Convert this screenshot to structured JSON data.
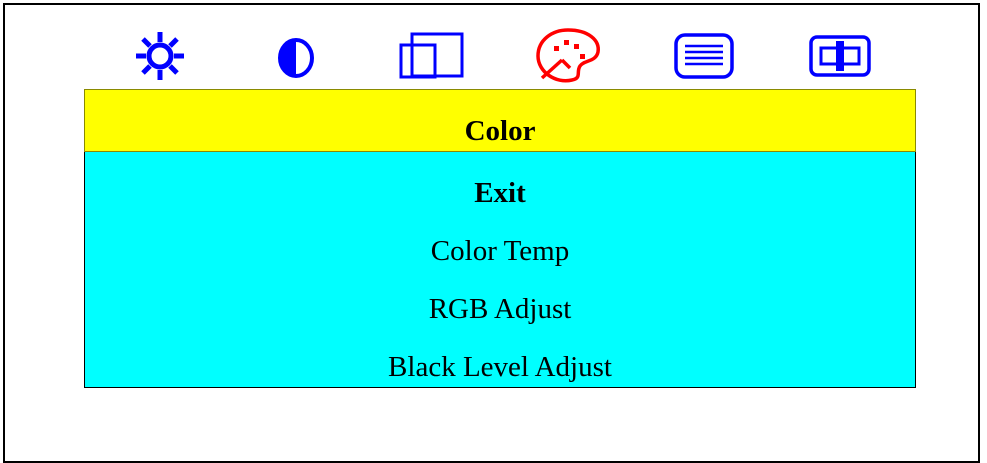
{
  "osd": {
    "tabs": [
      {
        "icon": "brightness-sun-icon",
        "color": "#0000ff",
        "selected": false
      },
      {
        "icon": "contrast-icon",
        "color": "#0000ff",
        "selected": false
      },
      {
        "icon": "image-position-icon",
        "color": "#0000ff",
        "selected": false
      },
      {
        "icon": "color-palette-icon",
        "color": "#ff0000",
        "selected": true
      },
      {
        "icon": "menu-lines-icon",
        "color": "#0000ff",
        "selected": false
      },
      {
        "icon": "input-signal-icon",
        "color": "#0000ff",
        "selected": false
      }
    ],
    "title": "Color",
    "title_bg": "#ffff00",
    "panel_bg": "#00ffff",
    "menu_items": [
      {
        "label": "Exit",
        "bold": true
      },
      {
        "label": "Color Temp",
        "bold": false
      },
      {
        "label": "RGB Adjust",
        "bold": false
      },
      {
        "label": "Black Level Adjust",
        "bold": false
      }
    ]
  }
}
